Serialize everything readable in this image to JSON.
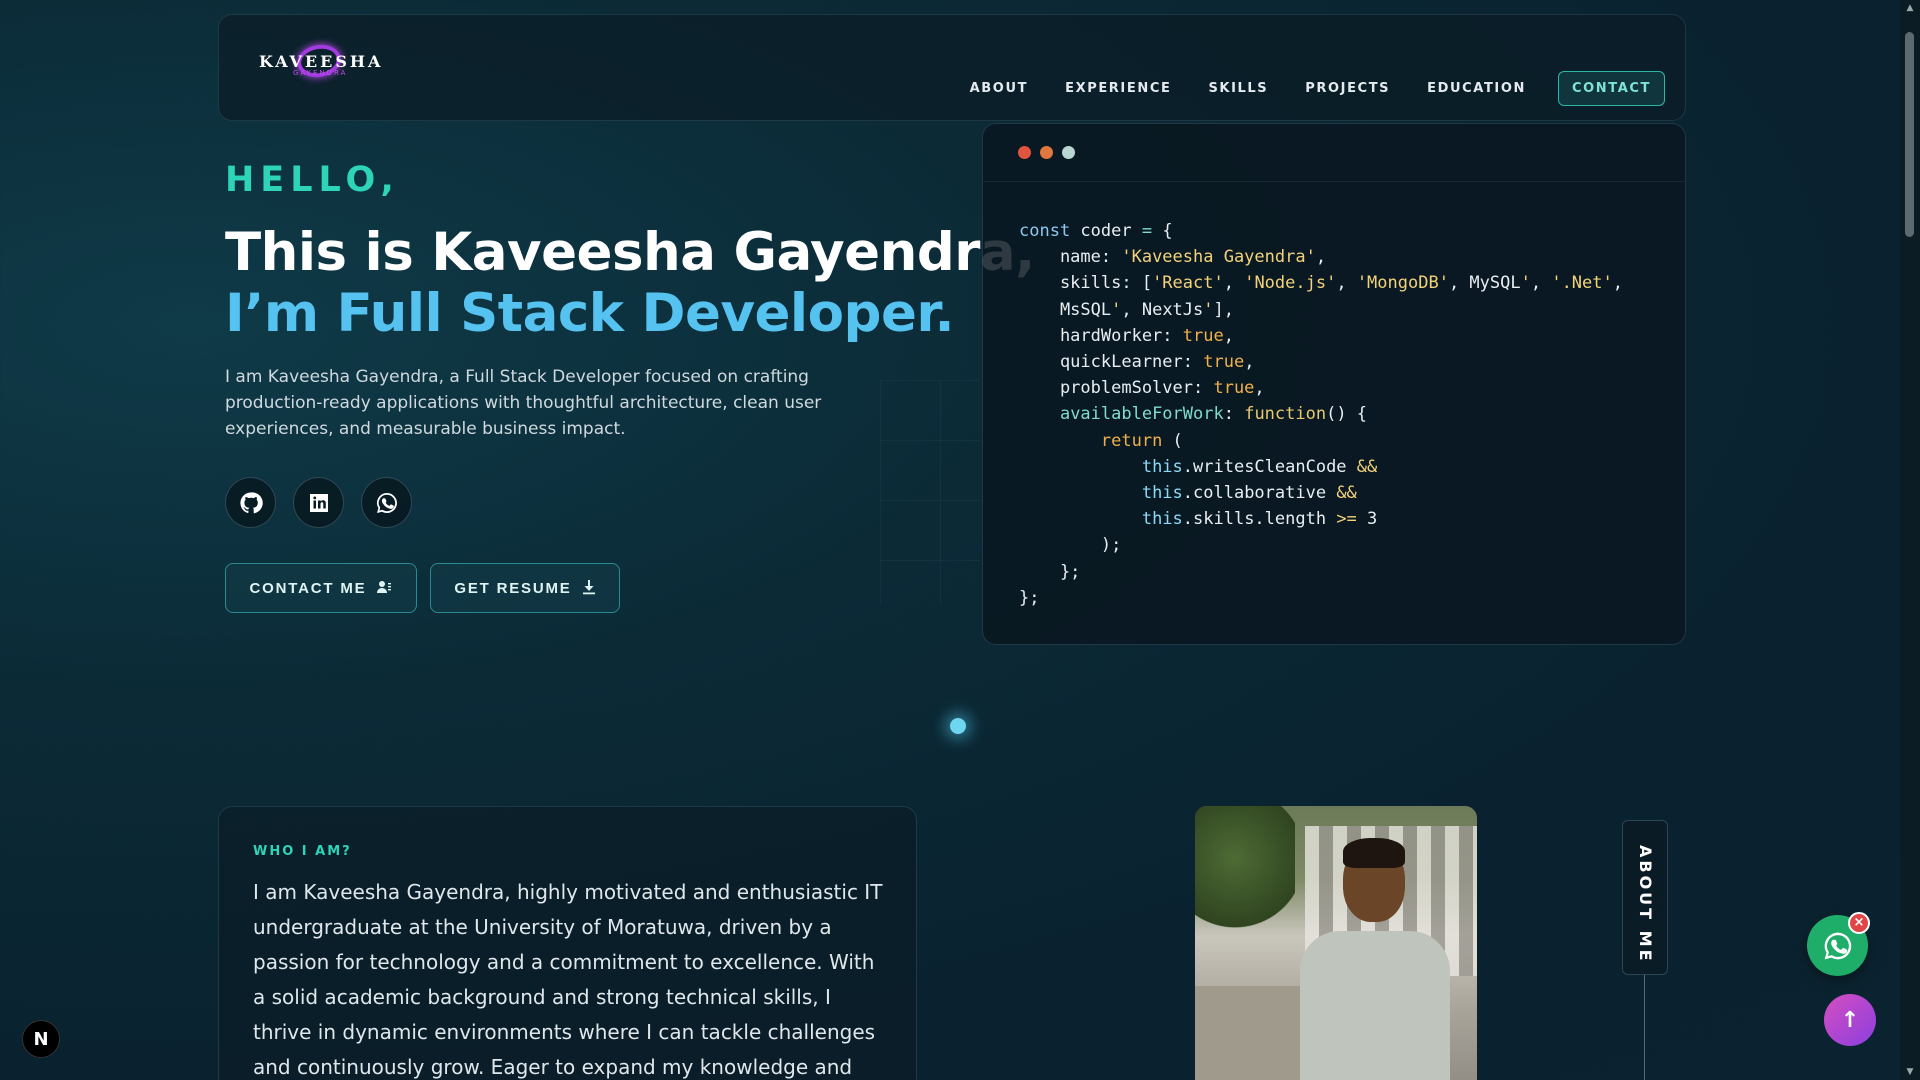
{
  "header": {
    "logo_text": "KAVEESHA",
    "logo_sub": "GAYENDRA",
    "nav": [
      {
        "label": "ABOUT"
      },
      {
        "label": "EXPERIENCE"
      },
      {
        "label": "SKILLS"
      },
      {
        "label": "PROJECTS"
      },
      {
        "label": "EDUCATION"
      }
    ],
    "contact_label": "CONTACT"
  },
  "hero": {
    "hello": "HELLO,",
    "title": "This is Kaveesha Gayendra,",
    "role": "I’m Full Stack Developer.",
    "description": "I am Kaveesha Gayendra, a Full Stack Developer focused on crafting production-ready applications with thoughtful architecture, clean user experiences, and measurable business impact.",
    "socials": [
      "github-icon",
      "linkedin-icon",
      "whatsapp-icon"
    ],
    "contact_button": "CONTACT ME",
    "resume_button": "GET RESUME"
  },
  "code": {
    "lines": [
      "const coder = {",
      "    name: 'Kaveesha Gayendra',",
      "    skills: ['React', 'Node.js', 'MongoDB', MySQL', '.Net',",
      "    MsSQL', NextJs'],",
      "    hardWorker: true,",
      "    quickLearner: true,",
      "    problemSolver: true,",
      "    availableForWork: function() {",
      "        return (",
      "            this.writesCleanCode &&",
      "            this.collaborative &&",
      "            this.skills.length >= 3",
      "        );",
      "    };",
      "};"
    ]
  },
  "about": {
    "label": "WHO I AM?",
    "text": "I am Kaveesha Gayendra, highly motivated and enthusiastic IT undergraduate at the University of Moratuwa, driven by a passion for technology and a commitment to excellence. With a solid academic background and strong technical skills, I thrive in dynamic environments where I can tackle challenges and continuously grow. Eager to expand my knowledge and stay at",
    "side_tab": "ABOUT ME"
  },
  "floating": {
    "close_symbol": "×",
    "top_symbol": "↑",
    "badge": "N"
  },
  "colors": {
    "accent": "#2dd4b7",
    "role": "#56c2f0",
    "background": "#0b2a36"
  }
}
